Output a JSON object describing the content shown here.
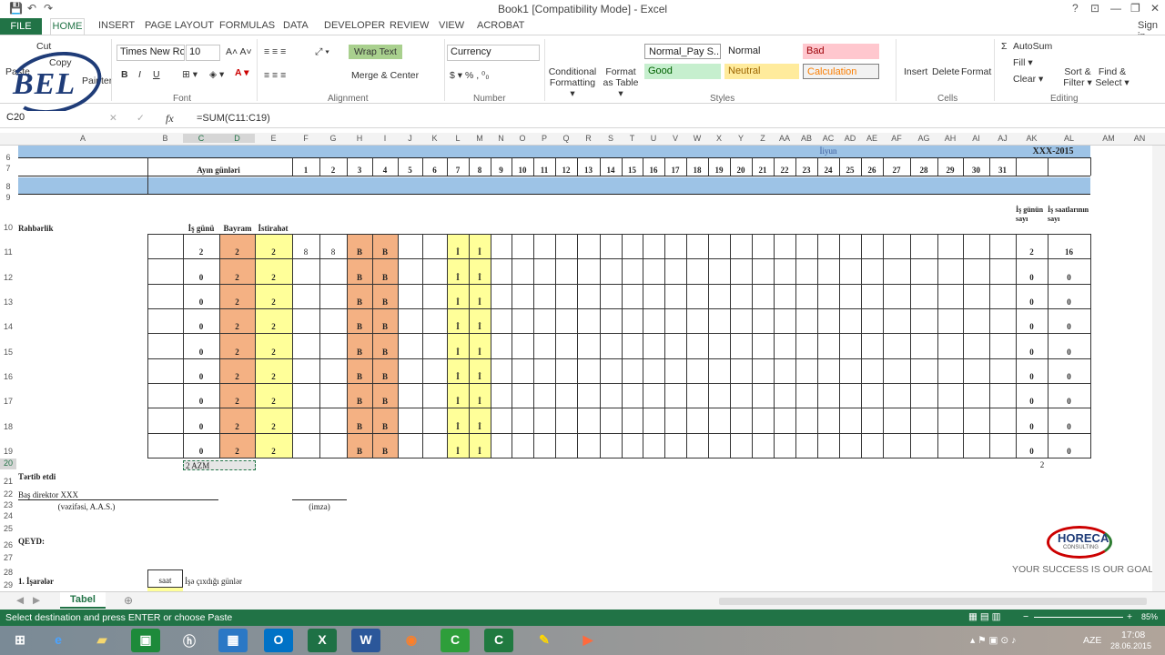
{
  "window": {
    "title": "Book1  [Compatibility Mode] - Excel",
    "controls": [
      "?",
      "⊡",
      "—",
      "❐",
      "✕"
    ]
  },
  "qat": [
    "💾",
    "↶",
    "↷"
  ],
  "tabs": {
    "file": "FILE",
    "items": [
      "HOME",
      "INSERT",
      "PAGE LAYOUT",
      "FORMULAS",
      "DATA",
      "DEVELOPER",
      "REVIEW",
      "VIEW",
      "ACROBAT"
    ],
    "signin": "Sign in"
  },
  "ribbon": {
    "clipboard": {
      "cut": "Cut",
      "copy": "Copy",
      "paste": "Paste",
      "painter": "Painter"
    },
    "font": {
      "name": "Times New Ro",
      "size": "10",
      "label": "Font"
    },
    "alignment": {
      "wrap": "Wrap Text",
      "merge": "Merge & Center",
      "label": "Alignment"
    },
    "number": {
      "format": "Currency",
      "label": "Number"
    },
    "cond": "Conditional Formatting ▾",
    "fmt_table": "Format as Table ▾",
    "styles": {
      "items": [
        "Normal_Pay S...",
        "Normal",
        "Bad",
        "Good",
        "Neutral",
        "Calculation"
      ],
      "label": "Styles",
      "colors": {
        "bad": "#ffc7ce",
        "good": "#c6efce",
        "neutral": "#ffeb9c",
        "calc": "#f2f2f2"
      }
    },
    "cells": {
      "insert": "Insert",
      "delete": "Delete",
      "format": "Format",
      "label": "Cells"
    },
    "editing": {
      "autosum": "AutoSum",
      "fill": "Fill ▾",
      "clear": "Clear ▾",
      "sort": "Sort & Filter ▾",
      "find": "Find & Select ▾",
      "label": "Editing"
    }
  },
  "formula_bar": {
    "cell": "C20",
    "fx": "fx",
    "formula": "=SUM(C11:C19)"
  },
  "columns": [
    "A",
    "B",
    "C",
    "D",
    "E",
    "F",
    "G",
    "H",
    "I",
    "J",
    "K",
    "L",
    "M",
    "N",
    "O",
    "P",
    "Q",
    "R",
    "S",
    "T",
    "U",
    "V",
    "W",
    "X",
    "Y",
    "Z",
    "AA",
    "AB",
    "AC",
    "AD",
    "AE",
    "AF",
    "AG",
    "AH",
    "AI",
    "AJ",
    "AK",
    "AL",
    "AM",
    "AN"
  ],
  "rows": [
    "6",
    "7",
    "8",
    "9",
    "10",
    "11",
    "12",
    "13",
    "14",
    "15",
    "16",
    "17",
    "18",
    "19",
    "20",
    "21",
    "22",
    "23",
    "24",
    "25",
    "26",
    "27",
    "28",
    "29"
  ],
  "sheet": {
    "month": "İiyun",
    "year": "XXX-2015",
    "ayin": "Ayın günləri",
    "days": [
      "1",
      "2",
      "3",
      "4",
      "5",
      "6",
      "7",
      "8",
      "9",
      "10",
      "11",
      "12",
      "13",
      "14",
      "15",
      "16",
      "17",
      "18",
      "19",
      "20",
      "21",
      "22",
      "23",
      "24",
      "25",
      "26",
      "27",
      "28",
      "29",
      "30",
      "31"
    ],
    "rehberlik": "Rəhbərlik",
    "is_gunu": "İş günü",
    "bayram": "Bayram",
    "istirahet": "İstirahət",
    "is_gunun_sayi": "İş günün sayı",
    "is_saat": "İş saatlarının sayı",
    "first_row": {
      "c": "2",
      "d": "2",
      "e": "2",
      "f": "8",
      "g": "8",
      "h": "B",
      "i": "B",
      "l": "İ",
      "m": "İ",
      "ak": "2",
      "al": "16"
    },
    "other_row": {
      "c": "0",
      "d": "2",
      "e": "2",
      "h": "B",
      "i": "B",
      "l": "İ",
      "m": "İ",
      "ak": "0",
      "al": "0"
    },
    "r20c": "2 AZM",
    "r20ak": "2",
    "tertib": "Tərtib etdi",
    "bas": "Baş direktor XXX",
    "vezife": "(vəzifəsi, A.A.S.)",
    "imza": "(imza)",
    "qeyd": "QEYD:",
    "isareler": "1. İşarələr",
    "saat": "saat",
    "ise_cixdigi": "İşə çıxdığı günlər",
    "colors": {
      "band": "#9dc3e6",
      "orange": "#f4b183",
      "yellow": "#ffff99"
    }
  },
  "logo": {
    "text": "HORECA",
    "sub": "CONSULTING",
    "slogan": "YOUR SUCCESS IS OUR GOAL !",
    "bel": "BEL"
  },
  "sheet_tab": "Tabel",
  "status": {
    "msg": "Select destination and press ENTER or choose Paste",
    "zoom": "85%"
  },
  "taskbar": {
    "time": "17:08",
    "date": "28.06.2015",
    "lang": "AZE"
  }
}
